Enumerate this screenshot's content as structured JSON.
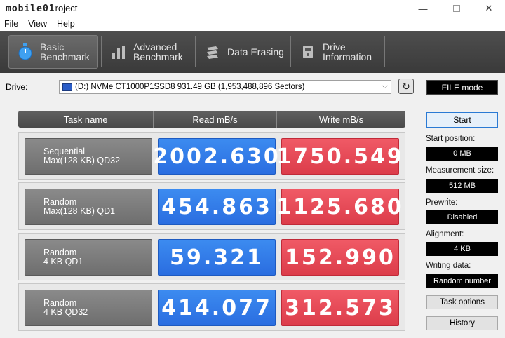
{
  "window": {
    "title_logo": "mobile01",
    "title_suffix": "roject",
    "minimize": "—",
    "close": "✕"
  },
  "menu": [
    "File",
    "View",
    "Help"
  ],
  "toolbar": {
    "tabs": [
      {
        "line1": "Basic",
        "line2": "Benchmark",
        "icon": "stopwatch-icon",
        "active": true
      },
      {
        "line1": "Advanced",
        "line2": "Benchmark",
        "icon": "bar-chart-icon",
        "active": false
      },
      {
        "line1": "Data Erasing",
        "line2": "",
        "icon": "eraser-icon",
        "active": false
      },
      {
        "line1": "Drive",
        "line2": "Information",
        "icon": "drive-info-icon",
        "active": false
      }
    ]
  },
  "drive": {
    "label": "Drive:",
    "selected": "(D:) NVMe CT1000P1SSD8  931.49 GB (1,953,488,896 Sectors)",
    "mode": "FILE mode"
  },
  "table": {
    "headers": [
      "Task name",
      "Read mB/s",
      "Write mB/s"
    ],
    "rows": [
      {
        "task_line1": "Sequential",
        "task_line2": "Max(128 KB) QD32",
        "read": "2002.630",
        "write": "1750.549"
      },
      {
        "task_line1": "Random",
        "task_line2": "Max(128 KB) QD1",
        "read": "454.863",
        "write": "1125.680"
      },
      {
        "task_line1": "Random",
        "task_line2": "4 KB QD1",
        "read": "59.321",
        "write": "152.990"
      },
      {
        "task_line1": "Random",
        "task_line2": "4 KB QD32",
        "read": "414.077",
        "write": "312.573"
      }
    ]
  },
  "panel": {
    "start": "Start",
    "start_position_label": "Start position:",
    "start_position": "0 MB",
    "measurement_size_label": "Measurement size:",
    "measurement_size": "512 MB",
    "prewrite_label": "Prewrite:",
    "prewrite": "Disabled",
    "alignment_label": "Alignment:",
    "alignment": "4 KB",
    "writing_data_label": "Writing data:",
    "writing_data": "Random number",
    "task_options": "Task options",
    "history": "History"
  },
  "colors": {
    "read": "#2f7be8",
    "write": "#e5485a",
    "toolbar": "#444444"
  }
}
